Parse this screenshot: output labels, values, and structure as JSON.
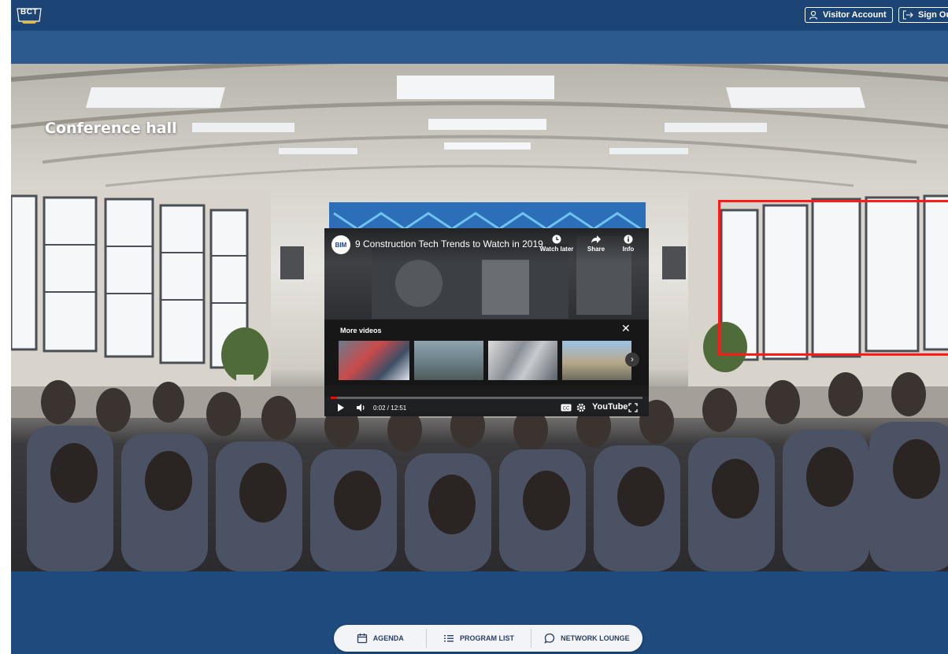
{
  "header": {
    "logo_text": "BCT",
    "visitor_account_label": "Visitor Account",
    "sign_out_label": "Sign Out",
    "icons": {
      "visitor": "user-icon",
      "sign_out": "sign-out-icon"
    }
  },
  "scene": {
    "title": "Conference hall",
    "highlight_color": "#ff1a1a"
  },
  "video": {
    "channel_badge": "BIM",
    "title": "9 Construction Tech Trends to Watch in 2019",
    "actions": {
      "watch_later": "Watch later",
      "share": "Share",
      "info": "Info"
    },
    "more_videos_label": "More videos",
    "close_symbol": "✕",
    "next_symbol": "›",
    "time": "0:02 / 12:51",
    "progress_fraction": 0.003,
    "brand": "YouTube"
  },
  "nav": {
    "agenda_label": "AGENDA",
    "program_list_label": "PROGRAM LIST",
    "network_lounge_label": "NETWORK LOUNGE"
  },
  "colors": {
    "header_bg": "#1c4576",
    "page_bg": "#1e4a7d",
    "nav_text": "#2a3e66"
  }
}
